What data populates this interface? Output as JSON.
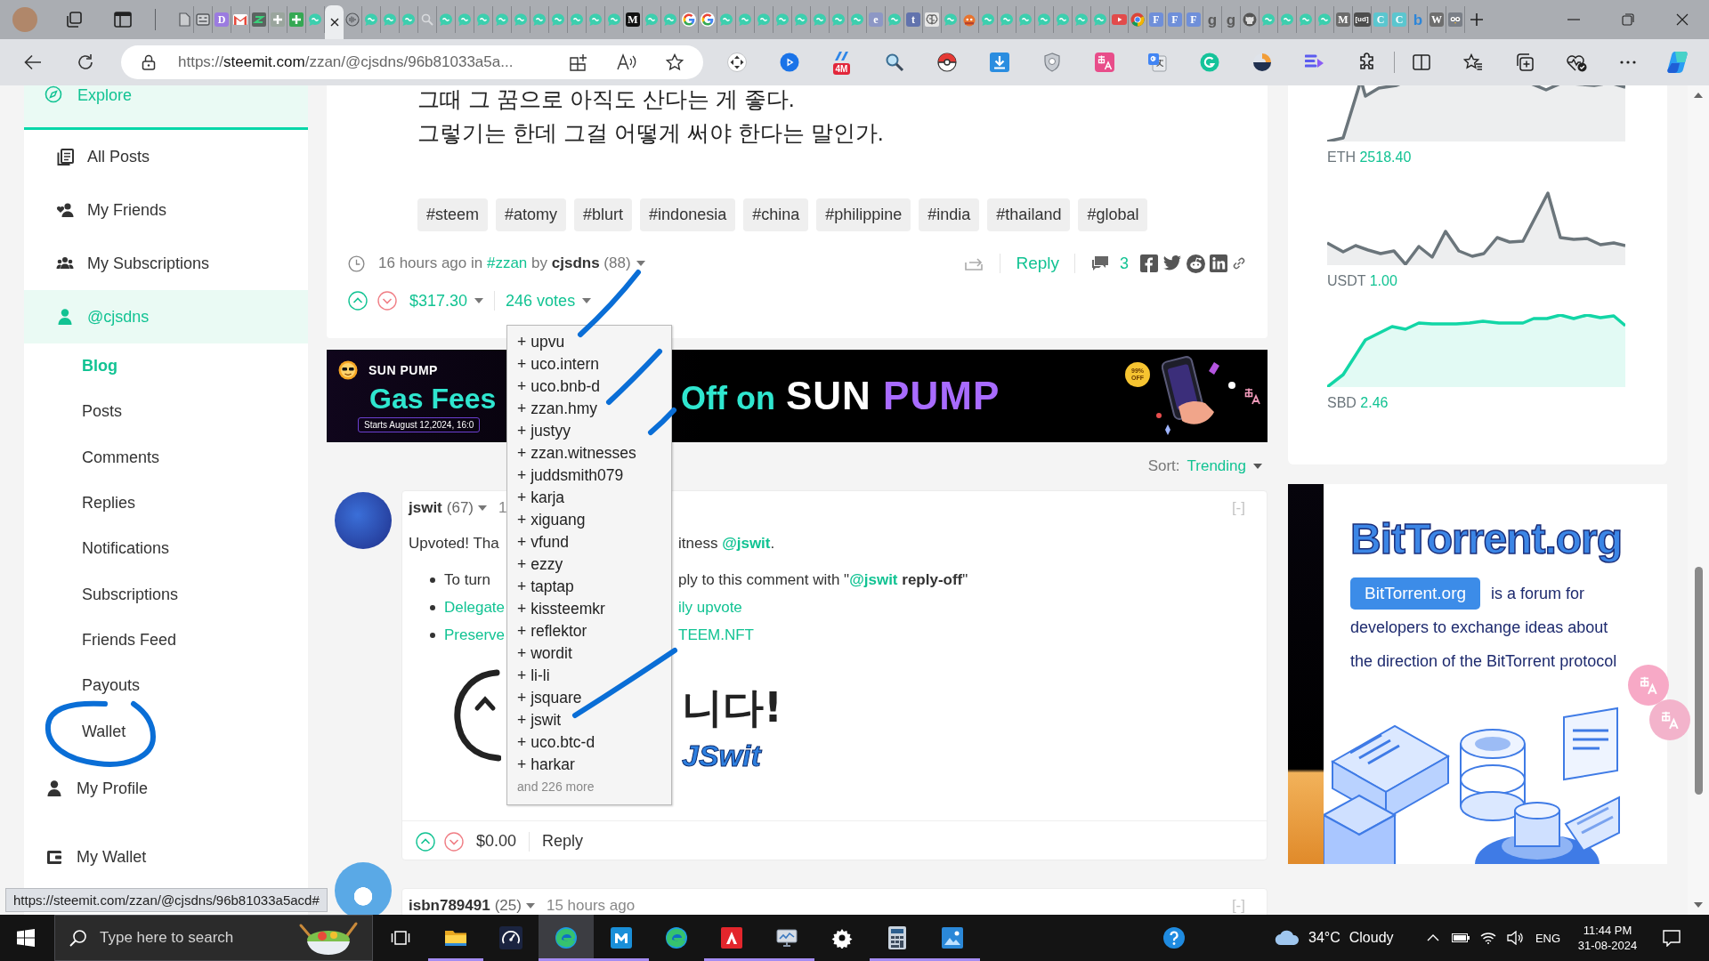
{
  "browser": {
    "tabs": [
      {
        "kind": "page",
        "selected": false
      },
      {
        "kind": "window",
        "selected": false
      },
      {
        "kind": "letter",
        "glyph": "D",
        "color": "#9b7be0",
        "selected": false
      },
      {
        "kind": "mail",
        "selected": false
      },
      {
        "kind": "zigzag",
        "selected": false
      },
      {
        "kind": "plus",
        "color": "#9aa59d",
        "selected": false
      },
      {
        "kind": "plus",
        "color": "#35a853",
        "selected": false
      },
      {
        "kind": "bubble",
        "selected": false
      },
      {
        "kind": "close",
        "selected": true
      },
      {
        "kind": "wave",
        "selected": false
      },
      {
        "kind": "bubble",
        "selected": false
      },
      {
        "kind": "bubble",
        "selected": false
      },
      {
        "kind": "bubble",
        "selected": false
      },
      {
        "kind": "search",
        "selected": false
      },
      {
        "kind": "bubble",
        "selected": false
      },
      {
        "kind": "bubble",
        "selected": false
      },
      {
        "kind": "bubble",
        "selected": false
      },
      {
        "kind": "bubble",
        "selected": false
      },
      {
        "kind": "bubble",
        "selected": false
      },
      {
        "kind": "bubble",
        "selected": false
      },
      {
        "kind": "bubble",
        "selected": false
      },
      {
        "kind": "bubble",
        "selected": false
      },
      {
        "kind": "bubble",
        "selected": false
      },
      {
        "kind": "bubble",
        "selected": false
      },
      {
        "kind": "letter",
        "glyph": "M",
        "color": "#111111",
        "selected": false
      },
      {
        "kind": "bubble",
        "selected": false
      },
      {
        "kind": "bubble",
        "selected": false
      },
      {
        "kind": "google",
        "selected": false
      },
      {
        "kind": "google",
        "selected": false
      },
      {
        "kind": "bubble",
        "selected": false
      },
      {
        "kind": "bubble",
        "selected": false
      },
      {
        "kind": "bubble",
        "selected": false
      },
      {
        "kind": "bubble",
        "selected": false
      },
      {
        "kind": "bubble",
        "selected": false
      },
      {
        "kind": "bubble",
        "selected": false
      },
      {
        "kind": "bubble",
        "selected": false
      },
      {
        "kind": "bubble",
        "selected": false
      },
      {
        "kind": "letter",
        "glyph": "e",
        "color": "#8d97c5",
        "selected": false
      },
      {
        "kind": "bubble",
        "selected": false
      },
      {
        "kind": "letter",
        "glyph": "t",
        "color": "#6273ad",
        "selected": false
      },
      {
        "kind": "brain",
        "selected": false
      },
      {
        "kind": "bubble",
        "selected": false
      },
      {
        "kind": "mascot",
        "selected": false
      },
      {
        "kind": "bubble",
        "selected": false
      },
      {
        "kind": "bubble",
        "selected": false
      },
      {
        "kind": "bubble",
        "selected": false
      },
      {
        "kind": "bubble",
        "selected": false
      },
      {
        "kind": "bubble",
        "selected": false
      },
      {
        "kind": "bubble",
        "selected": false
      },
      {
        "kind": "bubble",
        "selected": false
      },
      {
        "kind": "video",
        "selected": false
      },
      {
        "kind": "ring",
        "selected": false
      },
      {
        "kind": "letter",
        "glyph": "F",
        "color": "#6f8fd9",
        "selected": false
      },
      {
        "kind": "letter",
        "glyph": "F",
        "color": "#6f8fd9",
        "selected": false
      },
      {
        "kind": "letter",
        "glyph": "F",
        "color": "#6f8fd9",
        "selected": false
      },
      {
        "kind": "glyph",
        "glyph": "g",
        "color": "#5a5a5a",
        "selected": false
      },
      {
        "kind": "glyph",
        "glyph": "g",
        "color": "#5a5a5a",
        "selected": false
      },
      {
        "kind": "octocat",
        "selected": false
      },
      {
        "kind": "bubble",
        "selected": false
      },
      {
        "kind": "bubble",
        "selected": false
      },
      {
        "kind": "bubble",
        "selected": false
      },
      {
        "kind": "bubble",
        "selected": false
      },
      {
        "kind": "letter",
        "glyph": "M",
        "color": "#6b6b6b",
        "selected": false
      },
      {
        "kind": "letter",
        "glyph": "[ud]",
        "color": "#4d4d4d",
        "selected": false
      },
      {
        "kind": "letter",
        "glyph": "C",
        "color": "#5bc6cf",
        "selected": false
      },
      {
        "kind": "letter",
        "glyph": "C",
        "color": "#5bc6cf",
        "selected": false
      },
      {
        "kind": "glyph",
        "glyph": "b",
        "color": "#2d86d9",
        "selected": false
      },
      {
        "kind": "letter",
        "glyph": "W",
        "color": "#6e6e6e",
        "selected": false
      },
      {
        "kind": "owl",
        "selected": false
      }
    ],
    "url": {
      "scheme": "https://",
      "host": "steemit.com",
      "path": "/zzan/@cjsdns/96b81033a5a..."
    },
    "extensions": [
      {
        "kind": "dpad"
      },
      {
        "kind": "play"
      },
      {
        "kind": "badge",
        "badge": "4M"
      },
      {
        "kind": "magnifier"
      },
      {
        "kind": "ball"
      },
      {
        "kind": "download"
      },
      {
        "kind": "shield"
      },
      {
        "kind": "translate"
      },
      {
        "kind": "gtranslate"
      },
      {
        "kind": "grammar"
      },
      {
        "kind": "orb"
      },
      {
        "kind": "playlist"
      },
      {
        "kind": "puzzle"
      }
    ]
  },
  "sidebar": {
    "header": "Explore",
    "items": [
      {
        "label": "All Posts",
        "selected": false
      },
      {
        "label": "My Friends",
        "selected": false
      },
      {
        "label": "My Subscriptions",
        "selected": false
      },
      {
        "label": "@cjsdns",
        "selected": true,
        "children": [
          {
            "label": "Blog",
            "selected": true
          },
          {
            "label": "Posts",
            "selected": false
          },
          {
            "label": "Comments",
            "selected": false
          },
          {
            "label": "Replies",
            "selected": false
          },
          {
            "label": "Notifications",
            "selected": false
          },
          {
            "label": "Subscriptions",
            "selected": false
          },
          {
            "label": "Friends Feed",
            "selected": false
          },
          {
            "label": "Payouts",
            "selected": false
          },
          {
            "label": "Wallet",
            "selected": false
          }
        ]
      }
    ],
    "footer_items": [
      {
        "label": "My Profile"
      },
      {
        "label": "My Wallet"
      }
    ]
  },
  "post": {
    "body": [
      "그때 그 꿈으로 아직도 산다는 게 좋다.",
      "그렇기는 한데 그걸 어떻게 써야 한다는 말인가."
    ],
    "tags": [
      "#steem",
      "#atomy",
      "#blurt",
      "#indonesia",
      "#china",
      "#philippine",
      "#india",
      "#thailand",
      "#global"
    ],
    "meta": {
      "before": "16 hours ago in",
      "community": "#zzan",
      "by": "by",
      "author": "cjsdns",
      "reputation": "(88)"
    },
    "reply": "Reply",
    "comment_count": "3",
    "payout": "$317.30",
    "votes": "246 votes",
    "voters": {
      "items": [
        "+ upvu",
        "+ uco.intern",
        "+ uco.bnb-d",
        "+ zzan.hmy",
        "+ justyy",
        "+ zzan.witnesses",
        "+ juddsmith079",
        "+ karja",
        "+ xiguang",
        "+ vfund",
        "+ ezzy",
        "+ taptap",
        "+ kissteemkr",
        "+ reflektor",
        "+ wordit",
        "+ li-li",
        "+ jsquare",
        "+ jswit",
        "+ uco.btc-d",
        "+ harkar"
      ],
      "more": "and 226 more"
    }
  },
  "banner": {
    "brand": "SUN PUMP",
    "headline": "Gas Fees",
    "date": "Starts August 12,2024, 16:0",
    "slogan": "Off on",
    "product": "SUN",
    "product_accent": "PUMP",
    "badge": "99% OFF"
  },
  "sort": {
    "label": "Sort:",
    "value": "Trending"
  },
  "comments": [
    {
      "author": "jswit",
      "reputation": "(67)",
      "time": "1",
      "collapse": "[-]",
      "lines": [
        {
          "kind": "text",
          "bullet": false,
          "left": "Upvoted! Tha",
          "right": "itness ",
          "link": "@jswit",
          "end": "."
        },
        {
          "kind": "text",
          "bullet": true,
          "left": "To turn",
          "right": "ply to this comment with \"",
          "link": "@jswit",
          "end": " **reply-off**\""
        },
        {
          "kind": "link",
          "bullet": true,
          "left": "Delegate",
          "right": "ily upvote"
        },
        {
          "kind": "link",
          "bullet": true,
          "left": "Preserve",
          "right": "TEEM.NFT"
        }
      ],
      "sticker": {
        "text": "니다!",
        "logo": "JSwit"
      },
      "payout": "$0.00",
      "reply": "Reply"
    },
    {
      "author": "isbn789491",
      "reputation": "(25)",
      "time": "15 hours ago",
      "collapse": "[-]"
    }
  ],
  "market": [
    {
      "symbol": "ETH",
      "price": "2518.40",
      "color": "#6b757b"
    },
    {
      "symbol": "USDT",
      "price": "1.00",
      "color": "#6b757b"
    },
    {
      "symbol": "SBD",
      "price": "2.46",
      "color": "#12d6a6"
    }
  ],
  "side_ad": {
    "logo": "BitTorrent.org",
    "tag": "BitTorrent.org",
    "lines": [
      "is a forum for",
      "developers to exchange ideas about",
      "the direction of the BitTorrent protocol"
    ]
  },
  "status_url": "https://steemit.com/zzan/@cjsdns/96b81033a5acd#",
  "taskbar": {
    "search": {
      "placeholder": "Type here to search"
    },
    "apps": [
      {
        "kind": "taskview",
        "selected": false,
        "running": false
      },
      {
        "kind": "folder",
        "selected": false,
        "running": true
      },
      {
        "kind": "gauge",
        "selected": false,
        "running": false
      },
      {
        "kind": "browser",
        "selected": true,
        "running": true
      },
      {
        "kind": "mtile",
        "selected": false,
        "running": true
      },
      {
        "kind": "browser",
        "selected": false,
        "running": false
      },
      {
        "kind": "redtile",
        "selected": false,
        "running": true
      },
      {
        "kind": "monitor",
        "selected": false,
        "running": true
      },
      {
        "kind": "settings",
        "selected": false,
        "running": false
      },
      {
        "kind": "calculator",
        "selected": false,
        "running": true
      },
      {
        "kind": "photos",
        "selected": false,
        "running": true
      }
    ],
    "weather": {
      "temperature": "34°C",
      "condition": "Cloudy"
    },
    "language": "ENG",
    "time": "11:44 PM",
    "date": "31-08-2024"
  }
}
